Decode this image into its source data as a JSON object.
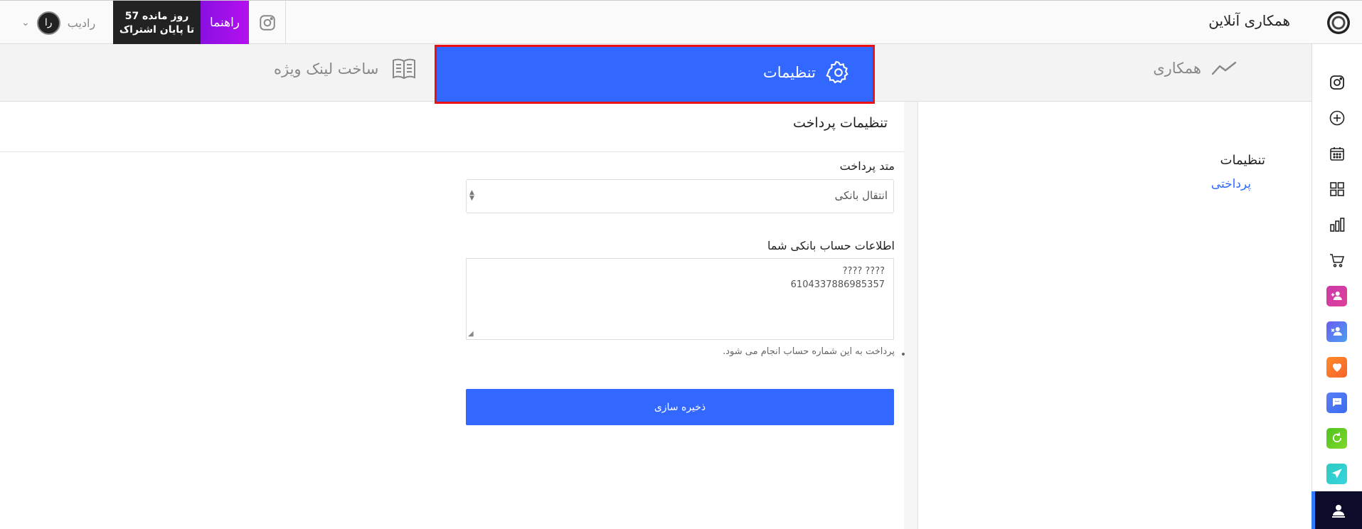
{
  "header": {
    "app_title": "همکاری آنلاین",
    "user_name": "رادیب",
    "avatar_text": "را",
    "subscription_line1": "روز مانده 57",
    "subscription_line2": "تا پایان اشتراک",
    "guide_label": "راهنما"
  },
  "tabs": [
    {
      "label": "همکاری",
      "icon": "trend-line-icon"
    },
    {
      "label": "تنظیمات",
      "icon": "gear-icon",
      "active": true
    },
    {
      "label": "ساخت لینک ویژه",
      "icon": "book-icon"
    }
  ],
  "sidebar_icons": [
    "instagram-icon",
    "plus-circle-icon",
    "calendar-icon",
    "grid-icon",
    "bar-chart-icon",
    "cart-icon",
    "add-user-icon",
    "remove-user-icon",
    "heart-icon",
    "chat-icon",
    "refresh-icon",
    "send-icon",
    "profile-icon"
  ],
  "subnav": {
    "title": "تنظیمات",
    "link": "پرداختی"
  },
  "panel": {
    "title": "تنظیمات پرداخت",
    "method_label": "متد پرداخت",
    "method_value": "انتقال بانکی",
    "account_label": "اطلاعات حساب بانکی شما",
    "account_line1": "???? ????",
    "account_line2": "6104337886985357",
    "hint": "پرداخت به این شماره حساب انجام می شود.",
    "save_label": "ذخیره سازی"
  },
  "colors": {
    "accent": "#3268ff",
    "highlight_border": "#e11111",
    "guide_purple": "#a010e8"
  }
}
